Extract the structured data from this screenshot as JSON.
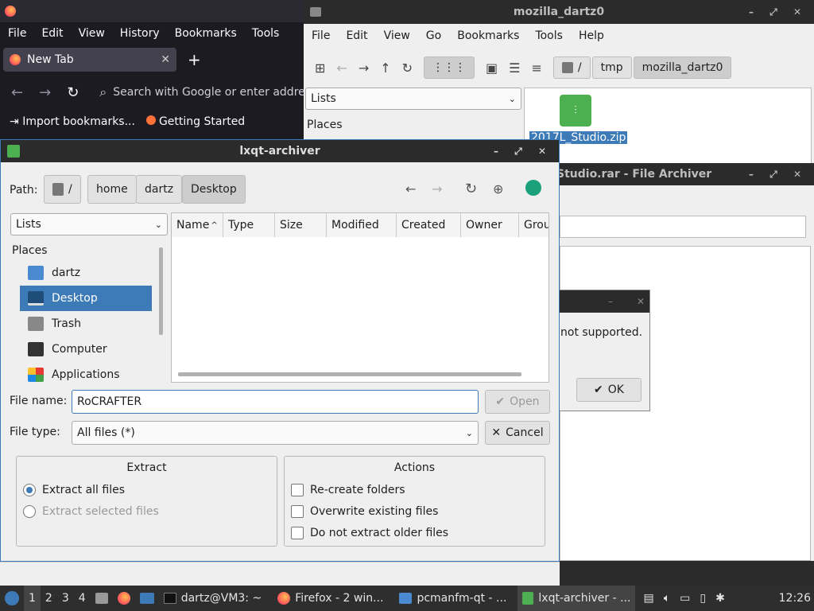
{
  "firefox": {
    "menu": [
      "File",
      "Edit",
      "View",
      "History",
      "Bookmarks",
      "Tools"
    ],
    "tab_title": "New Tab",
    "url_placeholder": "Search with Google or enter address",
    "bookmarks": [
      "Import bookmarks...",
      "Getting Started"
    ]
  },
  "pcmanfm": {
    "title": "mozilla_dartz0",
    "menu": [
      "File",
      "Edit",
      "View",
      "Go",
      "Bookmarks",
      "Tools",
      "Help"
    ],
    "path": [
      "/",
      "tmp",
      "mozilla_dartz0"
    ],
    "side_combo": "Lists",
    "places_label": "Places",
    "file_name": "2017L_Studio.zip"
  },
  "bg_archiver": {
    "title": "Studio.rar - File Archiver"
  },
  "error": {
    "message": "not supported.",
    "ok": "OK"
  },
  "dialog": {
    "title": "lxqt-archiver",
    "path_label": "Path:",
    "path": [
      "/",
      "home",
      "dartz",
      "Desktop"
    ],
    "side_combo": "Lists",
    "places_label": "Places",
    "places": [
      "dartz",
      "Desktop",
      "Trash",
      "Computer",
      "Applications"
    ],
    "columns": [
      "Name",
      "Type",
      "Size",
      "Modified",
      "Created",
      "Owner",
      "Grou"
    ],
    "file_name_label": "File name:",
    "file_name_value": "RoCRAFTER",
    "open": "Open",
    "file_type_label": "File type:",
    "file_type_value": "All files (*)",
    "cancel": "Cancel",
    "extract_title": "Extract",
    "extract_all": "Extract all files",
    "extract_selected": "Extract selected files",
    "actions_title": "Actions",
    "recreate": "Re-create folders",
    "overwrite": "Overwrite existing files",
    "older": "Do not extract older files"
  },
  "taskbar": {
    "desktops": [
      "1",
      "2",
      "3",
      "4"
    ],
    "tasks": [
      "dartz@VM3: ~",
      "Firefox - 2 win...",
      "pcmanfm-qt - ...",
      "lxqt-archiver - ..."
    ],
    "clock": "12:26"
  },
  "colors": {
    "accent": "#3d7ab8",
    "titlebar": "#2b2b2b"
  }
}
